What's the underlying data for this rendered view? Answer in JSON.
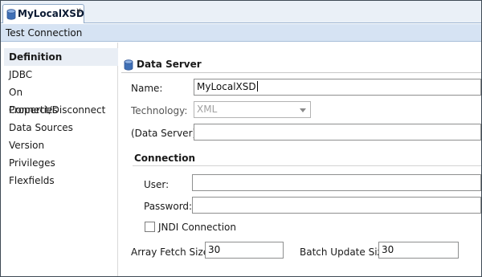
{
  "tab": {
    "title": "MyLocalXSD",
    "close": "x"
  },
  "toolbar": {
    "test_connection": "Test Connection"
  },
  "sidebar": {
    "items": [
      {
        "label": "Definition"
      },
      {
        "label": "JDBC"
      },
      {
        "label": "On Connect/Disconnect"
      },
      {
        "label": "Properties"
      },
      {
        "label": "Data Sources"
      },
      {
        "label": "Version"
      },
      {
        "label": "Privileges"
      },
      {
        "label": "Flexfields"
      }
    ]
  },
  "form": {
    "section_title": "Data Server",
    "name_label": "Name:",
    "name_value": "MyLocalXSD",
    "technology_label": "Technology:",
    "technology_value": "XML",
    "data_server_label": "(Data Server):",
    "data_server_value": "",
    "connection_title": "Connection",
    "user_label": "User:",
    "user_value": "",
    "password_label": "Password:",
    "password_value": "",
    "jndi_label": "JNDI Connection",
    "jndi_checked": false,
    "array_fetch_label": "Array Fetch Size:",
    "array_fetch_value": "30",
    "batch_update_label": "Batch Update Size:",
    "batch_update_value": "30"
  },
  "icons": {
    "tab": "database-icon",
    "section": "database-icon"
  },
  "colors": {
    "toolbar_bg": "#d6e3f3",
    "tabbar_bg": "#eaf0f7",
    "db_icon": "#3f6fb5"
  }
}
